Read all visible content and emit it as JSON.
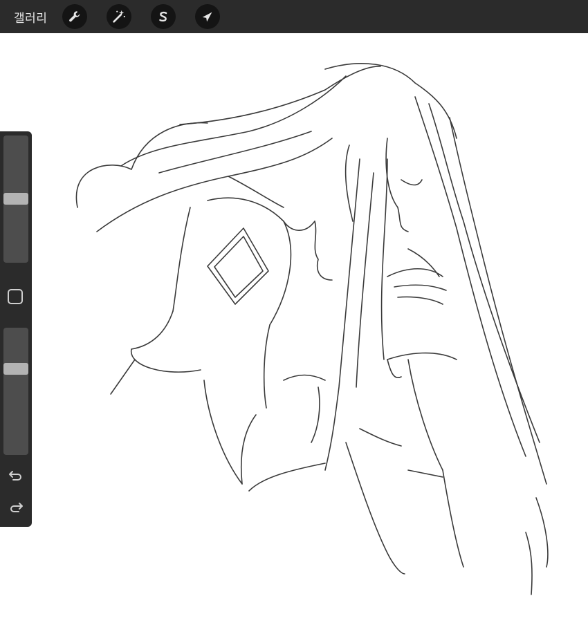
{
  "topbar": {
    "gallery_label": "갤러리",
    "tools": [
      {
        "name": "wrench-icon",
        "role": "actions"
      },
      {
        "name": "magic-wand-icon",
        "role": "adjustments"
      },
      {
        "name": "selection-s-icon",
        "role": "selection"
      },
      {
        "name": "arrow-cursor-icon",
        "role": "transform"
      }
    ]
  },
  "sidebar": {
    "brush_size_level": 0.5,
    "opacity_level": 0.35,
    "modify_icon": "square-outline-icon",
    "undo_icon": "undo-arrow-icon",
    "redo_icon": "redo-arrow-icon"
  },
  "colors": {
    "bar": "#2b2b2b",
    "tool_circle": "#141414",
    "icon": "#e6e6e6",
    "slider_track": "#4d4d4d",
    "slider_thumb": "#b3b3b3",
    "sketch_stroke": "#3a3a3a"
  }
}
